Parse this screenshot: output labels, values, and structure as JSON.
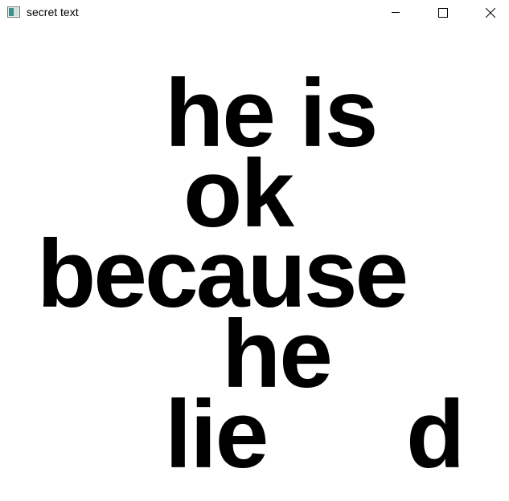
{
  "window": {
    "title": "secret text",
    "icon": "window-app-icon",
    "controls": {
      "minimize_icon": "minimize-icon",
      "maximize_icon": "maximize-icon",
      "close_icon": "close-icon"
    }
  },
  "content": {
    "lines": [
      "he is",
      "ok",
      "because",
      "he",
      "lie",
      "d"
    ]
  }
}
